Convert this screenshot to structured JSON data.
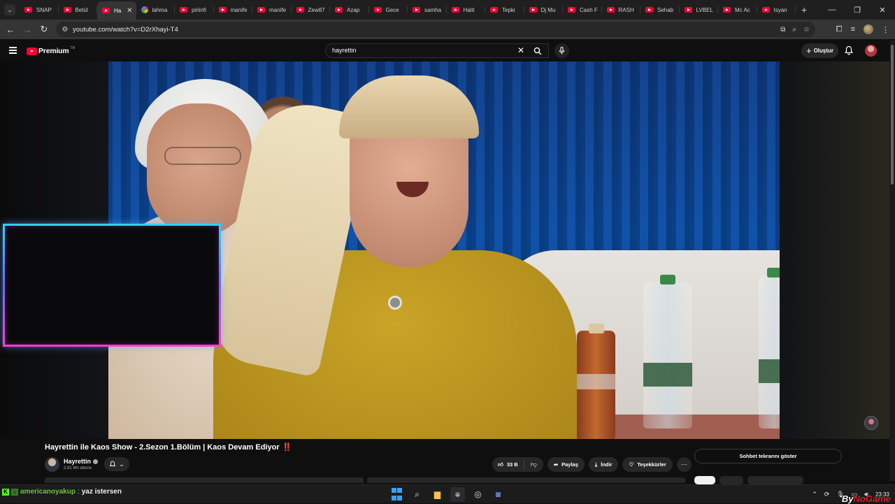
{
  "browser": {
    "tabs": [
      {
        "label": "SNAP",
        "icon": "youtube-icon"
      },
      {
        "label": "Betül",
        "icon": "youtube-icon"
      },
      {
        "label": "Ha",
        "icon": "youtube-icon",
        "active": true
      },
      {
        "label": "lahma",
        "icon": "google-icon"
      },
      {
        "label": "piriinfi",
        "icon": "youtube-icon"
      },
      {
        "label": "manife",
        "icon": "youtube-icon"
      },
      {
        "label": "manife",
        "icon": "youtube-icon"
      },
      {
        "label": "Zew87",
        "icon": "youtube-icon"
      },
      {
        "label": "Azap",
        "icon": "youtube-icon"
      },
      {
        "label": "Gece",
        "icon": "youtube-icon"
      },
      {
        "label": "samha",
        "icon": "youtube-icon"
      },
      {
        "label": "Halit",
        "icon": "youtube-icon"
      },
      {
        "label": "Tepki",
        "icon": "youtube-icon"
      },
      {
        "label": "Dj Mu",
        "icon": "youtube-icon"
      },
      {
        "label": "Cash F",
        "icon": "youtube-icon"
      },
      {
        "label": "RASH",
        "icon": "youtube-icon"
      },
      {
        "label": "Sehab",
        "icon": "youtube-icon"
      },
      {
        "label": "LVBEL",
        "icon": "youtube-icon"
      },
      {
        "label": "Mc Ac",
        "icon": "youtube-icon"
      },
      {
        "label": "Isyan",
        "icon": "youtube-icon"
      }
    ],
    "new_tab": "+",
    "url": "youtube.com/watch?v=D2rXhayi-T4"
  },
  "youtube": {
    "logo_text": "Premium",
    "logo_region": "TR",
    "search_query": "hayrettin",
    "create_label": "Oluştur",
    "video": {
      "title": "Hayrettin ile Kaos Show - 2.Sezon 1.Bölüm | Kaos Devam Ediyor",
      "title_emoji": "‼️",
      "channel_name": "Hayrettin",
      "subscribers": "2,91 Mn abone",
      "likes": "33 B",
      "share_label": "Paylaş",
      "download_label": "İndir",
      "thanks_label": "Teşekkürler",
      "chat_replay_label": "Sohbet tekrarını göster"
    }
  },
  "taskbar": {
    "chat_user": "americanoyakup",
    "chat_message": "yaz istersen",
    "time": "23:33"
  },
  "watermark": {
    "prefix": "By",
    "brand": "NoGame"
  },
  "colors": {
    "accent": "#ff0033",
    "neon_top": "#29d3ff",
    "neon_bottom": "#ff3bd8"
  }
}
